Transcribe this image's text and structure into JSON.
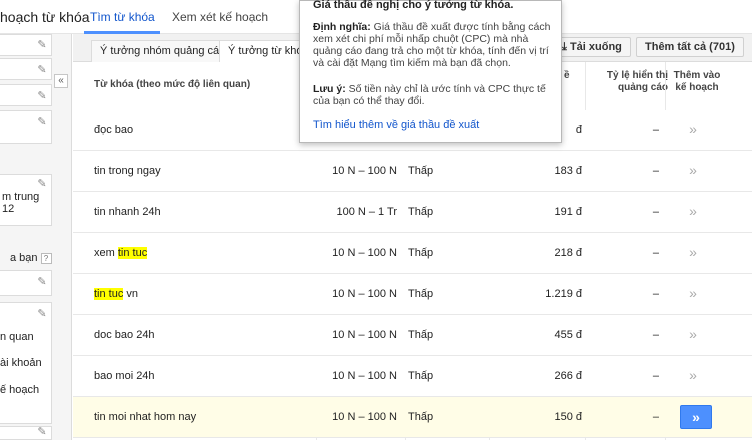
{
  "header": {
    "title": "hoạch từ khóa",
    "tabs": [
      "Tìm từ khóa",
      "Xem xét kế hoạch"
    ]
  },
  "sidebar": {
    "collapse_icon": "«",
    "texts": [
      "m trung",
      "12",
      "a bạn",
      "n quan",
      "ài khoản",
      "ế hoạch"
    ],
    "help_icon": "?"
  },
  "subtabs": [
    "Ý tưởng nhóm quảng cáo",
    "Ý tưởng từ khóa"
  ],
  "toolbar": {
    "download_label": "Tải xuống",
    "add_all_label": "Thêm tất cả (701)"
  },
  "columns": {
    "keyword": "Từ khóa (theo mức độ liên quan)",
    "bid_partial": "ề",
    "impression_share": "Tỷ lệ hiển thị quảng cáo",
    "add_to_plan": "Thêm vào kế hoạch"
  },
  "rows": [
    {
      "keyword": "đọc bao",
      "volume": "",
      "competition": "",
      "bid": "đ",
      "share": "–",
      "add": "»"
    },
    {
      "keyword": "tin trong ngay",
      "volume": "10 N – 100 N",
      "competition": "Thấp",
      "bid": "183 đ",
      "share": "–",
      "add": "»"
    },
    {
      "keyword": "tin nhanh 24h",
      "volume": "100 N – 1 Tr",
      "competition": "Thấp",
      "bid": "191 đ",
      "share": "–",
      "add": "»"
    },
    {
      "keyword_pre": "xem ",
      "keyword_mark": "tin tuc",
      "keyword_post": "",
      "volume": "10 N – 100 N",
      "competition": "Thấp",
      "bid": "218 đ",
      "share": "–",
      "add": "»"
    },
    {
      "keyword_pre": "",
      "keyword_mark": "tin tuc",
      "keyword_post": " vn",
      "volume": "10 N – 100 N",
      "competition": "Thấp",
      "bid": "1.219 đ",
      "share": "–",
      "add": "»"
    },
    {
      "keyword": "doc bao 24h",
      "volume": "10 N – 100 N",
      "competition": "Thấp",
      "bid": "455 đ",
      "share": "–",
      "add": "»"
    },
    {
      "keyword": "bao moi 24h",
      "volume": "10 N – 100 N",
      "competition": "Thấp",
      "bid": "266 đ",
      "share": "–",
      "add": "»"
    },
    {
      "keyword": "tin moi nhat hom nay",
      "volume": "10 N – 100 N",
      "competition": "Thấp",
      "bid": "150 đ",
      "share": "–",
      "add": "»"
    }
  ],
  "tooltip": {
    "title": "Giá thầu đề nghị cho ý tưởng từ khóa.",
    "def_label": "Định nghĩa:",
    "def_text": "Giá thầu đề xuất được tính bằng cách xem xét chi phí mỗi nhấp chuột (CPC) mà nhà quảng cáo đang trả cho một từ khóa, tính đến vị trí và cài đặt Mạng tìm kiếm mà bạn đã chọn.",
    "note_label": "Lưu ý:",
    "note_text": "Số tiền này chỉ là ước tính và CPC thực tế của bạn có thể thay đổi.",
    "link": "Tìm hiểu thêm về giá thầu đề xuất"
  },
  "colors": {
    "accent": "#4d90fe",
    "link": "#1155cc",
    "highlight": "#ffff00",
    "row_highlight": "#fffde7"
  }
}
